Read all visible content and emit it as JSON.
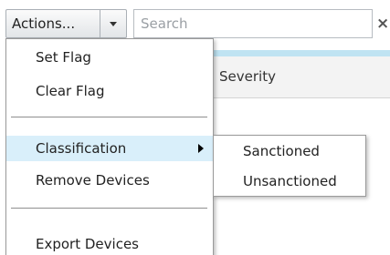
{
  "toolbar": {
    "actions_label": "Actions...",
    "dropdown_icon": "chevron-down-icon",
    "search_placeholder": "Search",
    "search_value": "",
    "clear_icon": "close-icon",
    "clear_symbol": "×"
  },
  "table": {
    "header_accent_color": "#bfe3f2",
    "columns": [
      "Severity"
    ]
  },
  "menu": {
    "items": [
      {
        "label": "Set Flag"
      },
      {
        "label": "Clear Flag"
      },
      {
        "label": "Classification",
        "has_submenu": true,
        "highlighted": true
      },
      {
        "label": "Remove Devices"
      },
      {
        "label": "Export Devices"
      }
    ],
    "submenu_arrow_icon": "chevron-right-icon",
    "highlight_color": "#d9effa"
  },
  "submenu": {
    "items": [
      {
        "label": "Sanctioned"
      },
      {
        "label": "Unsanctioned"
      }
    ]
  }
}
